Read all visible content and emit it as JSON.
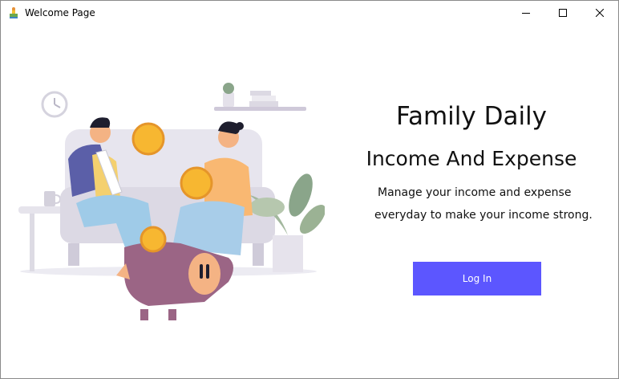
{
  "window": {
    "title": "Welcome Page",
    "app_icon": "app-icon",
    "controls": [
      "minimize-icon",
      "maximize-icon",
      "close-icon"
    ]
  },
  "main": {
    "heading_line1": "Family Daily",
    "heading_line2": "Income And Expense",
    "description_line1": "Manage your income and expense",
    "description_line2": "everyday to make your income strong.",
    "login_label": "Log In"
  },
  "colors": {
    "accent": "#5c56ff",
    "illustration_skin": "#f4b384",
    "illustration_coin": "#f7b731",
    "illustration_piggy": "#9b6585"
  }
}
